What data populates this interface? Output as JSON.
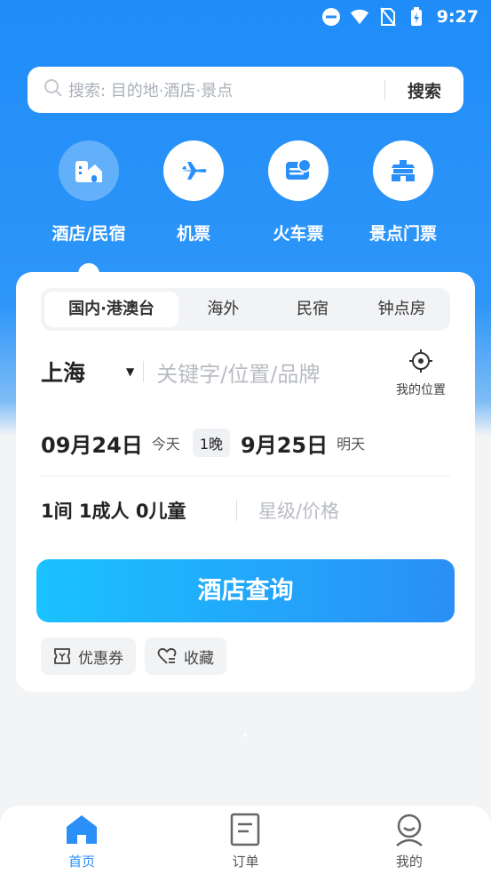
{
  "status_bar": {
    "time": "9:27"
  },
  "search": {
    "placeholder": "搜索: 目的地·酒店·景点",
    "button": "搜索"
  },
  "categories": [
    {
      "label": "酒店/民宿",
      "icon": "hotel-icon"
    },
    {
      "label": "机票",
      "icon": "plane-icon"
    },
    {
      "label": "火车票",
      "icon": "train-icon"
    },
    {
      "label": "景点门票",
      "icon": "attraction-icon"
    }
  ],
  "tabs": [
    "国内·港澳台",
    "海外",
    "民宿",
    "钟点房"
  ],
  "city": {
    "name": "上海",
    "keyword_placeholder": "关键字/位置/品牌",
    "locate_label": "我的位置"
  },
  "dates": {
    "checkin": "09月24日",
    "checkin_label": "今天",
    "nights": "1晚",
    "checkout": "9月25日",
    "checkout_label": "明天"
  },
  "guests": {
    "summary": "1间 1成人 0儿童",
    "star_placeholder": "星级/价格"
  },
  "query_button": "酒店查询",
  "chips": [
    "优惠券",
    "收藏"
  ],
  "bottom_nav": [
    {
      "label": "首页",
      "icon": "home-icon"
    },
    {
      "label": "订单",
      "icon": "order-icon"
    },
    {
      "label": "我的",
      "icon": "profile-icon"
    }
  ],
  "colors": {
    "brand": "#2a8ff6",
    "hero": "#1f8cf8"
  }
}
